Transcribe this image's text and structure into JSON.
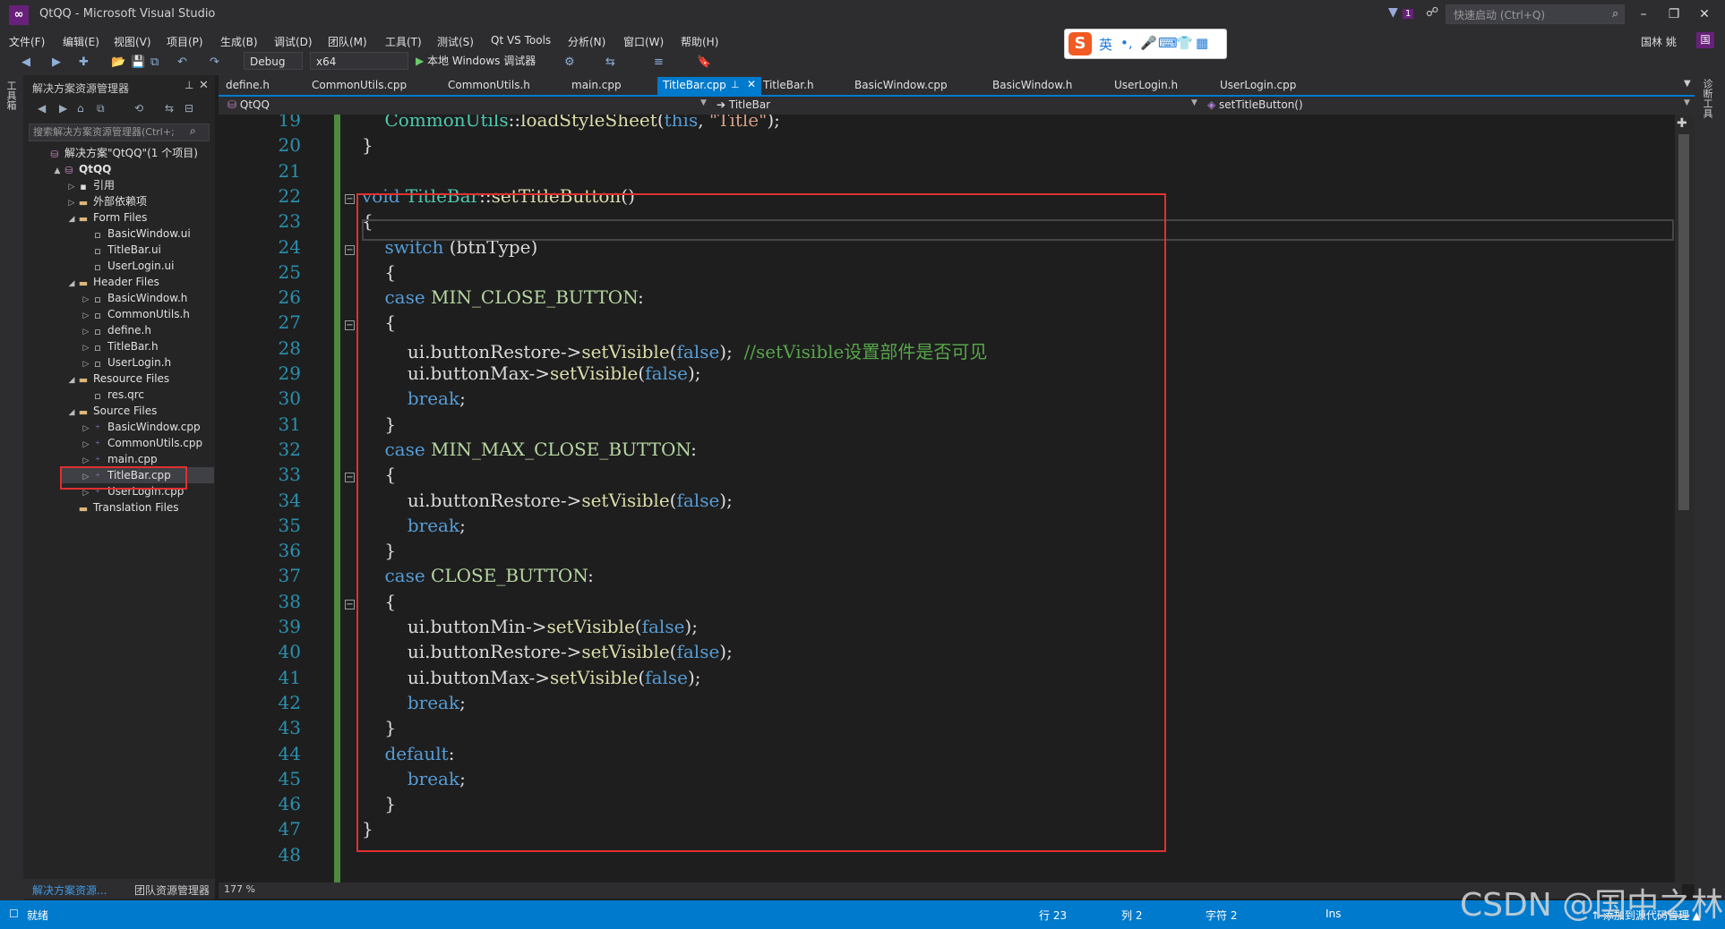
{
  "window": {
    "title": "QtQQ - Microsoft Visual Studio",
    "logo": "vs-logo",
    "quick_launch_placeholder": "快速启动 (Ctrl+Q)",
    "notification_count": "1",
    "user_name": "国林 姚",
    "user_initial": "国",
    "controls": [
      "minimize",
      "restore",
      "close"
    ]
  },
  "menu": [
    "文件(F)",
    "编辑(E)",
    "视图(V)",
    "项目(P)",
    "生成(B)",
    "调试(D)",
    "团队(M)",
    "工具(T)",
    "测试(S)",
    "Qt VS Tools",
    "分析(N)",
    "窗口(W)",
    "帮助(H)"
  ],
  "toolbar": {
    "config": "Debug",
    "platform": "x64",
    "run_label": "本地 Windows 调试器"
  },
  "ime": {
    "logo": "S",
    "items": [
      "英",
      "•,",
      "🎤",
      "⌨",
      "👕",
      "▦"
    ]
  },
  "left_strip": {
    "toolbox": "工具箱"
  },
  "right_strip": {
    "diagnostics": "诊断工具"
  },
  "solution_explorer": {
    "title": "解决方案资源管理器",
    "search_placeholder": "搜索解决方案资源管理器(Ctrl+;",
    "tree": [
      {
        "label": "解决方案\"QtQQ\"(1 个项目)",
        "indent": 0,
        "arrow": "",
        "icon": "solution-icon"
      },
      {
        "label": "QtQQ",
        "indent": 1,
        "arrow": "▲",
        "icon": "project-icon",
        "bold": true
      },
      {
        "label": "引用",
        "indent": 2,
        "arrow": "▷",
        "icon": "references-icon"
      },
      {
        "label": "外部依赖项",
        "indent": 2,
        "arrow": "▷",
        "icon": "folder-icon"
      },
      {
        "label": "Form Files",
        "indent": 2,
        "arrow": "◢",
        "icon": "folder-icon"
      },
      {
        "label": "BasicWindow.ui",
        "indent": 3,
        "arrow": "",
        "icon": "file-icon"
      },
      {
        "label": "TitleBar.ui",
        "indent": 3,
        "arrow": "",
        "icon": "file-icon"
      },
      {
        "label": "UserLogin.ui",
        "indent": 3,
        "arrow": "",
        "icon": "file-icon"
      },
      {
        "label": "Header Files",
        "indent": 2,
        "arrow": "◢",
        "icon": "folder-icon"
      },
      {
        "label": "BasicWindow.h",
        "indent": 3,
        "arrow": "▷",
        "icon": "header-icon"
      },
      {
        "label": "CommonUtils.h",
        "indent": 3,
        "arrow": "▷",
        "icon": "header-icon"
      },
      {
        "label": "define.h",
        "indent": 3,
        "arrow": "▷",
        "icon": "header-icon"
      },
      {
        "label": "TitleBar.h",
        "indent": 3,
        "arrow": "▷",
        "icon": "header-icon"
      },
      {
        "label": "UserLogin.h",
        "indent": 3,
        "arrow": "▷",
        "icon": "header-icon"
      },
      {
        "label": "Resource Files",
        "indent": 2,
        "arrow": "◢",
        "icon": "folder-icon"
      },
      {
        "label": "res.qrc",
        "indent": 3,
        "arrow": "",
        "icon": "file-icon"
      },
      {
        "label": "Source Files",
        "indent": 2,
        "arrow": "◢",
        "icon": "folder-icon"
      },
      {
        "label": "BasicWindow.cpp",
        "indent": 3,
        "arrow": "▷",
        "icon": "cpp-icon"
      },
      {
        "label": "CommonUtils.cpp",
        "indent": 3,
        "arrow": "▷",
        "icon": "cpp-icon"
      },
      {
        "label": "main.cpp",
        "indent": 3,
        "arrow": "▷",
        "icon": "cpp-icon"
      },
      {
        "label": "TitleBar.cpp",
        "indent": 3,
        "arrow": "▷",
        "icon": "cpp-icon",
        "selected": true
      },
      {
        "label": "UserLogin.cpp",
        "indent": 3,
        "arrow": "▷",
        "icon": "cpp-icon"
      },
      {
        "label": "Translation Files",
        "indent": 2,
        "arrow": "",
        "icon": "folder-icon"
      }
    ],
    "bottom_tabs": [
      "解决方案资源...",
      "团队资源管理器"
    ]
  },
  "tabs": [
    {
      "label": "define.h"
    },
    {
      "label": "CommonUtils.cpp"
    },
    {
      "label": "CommonUtils.h"
    },
    {
      "label": "main.cpp"
    },
    {
      "label": "TitleBar.cpp",
      "active": true
    },
    {
      "label": "TitleBar.h"
    },
    {
      "label": "BasicWindow.cpp"
    },
    {
      "label": "BasicWindow.h"
    },
    {
      "label": "UserLogin.h"
    },
    {
      "label": "UserLogin.cpp"
    }
  ],
  "navbar": {
    "project": "QtQQ",
    "scope": "TitleBar",
    "member": "setTitleButton()"
  },
  "editor": {
    "zoom": "177 %",
    "lines": [
      {
        "n": "19",
        "tokens": [
          [
            "    ",
            ""
          ],
          [
            "CommonUtils",
            "cls"
          ],
          [
            "::",
            ""
          ],
          [
            "loadStyleSheet",
            "fn"
          ],
          [
            "(",
            ""
          ],
          [
            "this",
            "kw"
          ],
          [
            ", ",
            ""
          ],
          [
            "\"Title\"",
            "str"
          ],
          [
            ");",
            ""
          ]
        ]
      },
      {
        "n": "20",
        "tokens": [
          [
            "}",
            ""
          ]
        ]
      },
      {
        "n": "21",
        "tokens": []
      },
      {
        "n": "22",
        "tokens": [
          [
            "void ",
            "kw"
          ],
          [
            "TitleBar",
            "cls"
          ],
          [
            "::",
            ""
          ],
          [
            "setTitleButton",
            "fn"
          ],
          [
            "()",
            ""
          ]
        ],
        "fold": true
      },
      {
        "n": "23",
        "tokens": [
          [
            "{",
            ""
          ]
        ]
      },
      {
        "n": "24",
        "tokens": [
          [
            "    ",
            ""
          ],
          [
            "switch",
            "kw"
          ],
          [
            " (",
            ""
          ],
          [
            "btnType",
            "var"
          ],
          [
            ")",
            ""
          ]
        ],
        "fold": true
      },
      {
        "n": "25",
        "tokens": [
          [
            "    {",
            ""
          ]
        ]
      },
      {
        "n": "26",
        "tokens": [
          [
            "    ",
            ""
          ],
          [
            "case",
            "kw"
          ],
          [
            " ",
            ""
          ],
          [
            "MIN_CLOSE_BUTTON",
            "cst"
          ],
          [
            ":",
            ""
          ]
        ]
      },
      {
        "n": "27",
        "tokens": [
          [
            "    {",
            ""
          ]
        ],
        "fold": true
      },
      {
        "n": "28",
        "tokens": [
          [
            "        ui",
            "var"
          ],
          [
            ".",
            ""
          ],
          [
            "buttonRestore",
            "var"
          ],
          [
            "->",
            ""
          ],
          [
            "setVisible",
            "fn"
          ],
          [
            "(",
            ""
          ],
          [
            "false",
            "kw"
          ],
          [
            ");  ",
            ""
          ],
          [
            "//setVisible设置部件是否可见",
            "cmt"
          ]
        ]
      },
      {
        "n": "29",
        "tokens": [
          [
            "        ui",
            "var"
          ],
          [
            ".",
            ""
          ],
          [
            "buttonMax",
            "var"
          ],
          [
            "->",
            ""
          ],
          [
            "setVisible",
            "fn"
          ],
          [
            "(",
            ""
          ],
          [
            "false",
            "kw"
          ],
          [
            ");",
            ""
          ]
        ]
      },
      {
        "n": "30",
        "tokens": [
          [
            "        ",
            ""
          ],
          [
            "break",
            "kw"
          ],
          [
            ";",
            ""
          ]
        ]
      },
      {
        "n": "31",
        "tokens": [
          [
            "    }",
            ""
          ]
        ]
      },
      {
        "n": "32",
        "tokens": [
          [
            "    ",
            ""
          ],
          [
            "case",
            "kw"
          ],
          [
            " ",
            ""
          ],
          [
            "MIN_MAX_CLOSE_BUTTON",
            "cst"
          ],
          [
            ":",
            ""
          ]
        ]
      },
      {
        "n": "33",
        "tokens": [
          [
            "    {",
            ""
          ]
        ],
        "fold": true
      },
      {
        "n": "34",
        "tokens": [
          [
            "        ui",
            "var"
          ],
          [
            ".",
            ""
          ],
          [
            "buttonRestore",
            "var"
          ],
          [
            "->",
            ""
          ],
          [
            "setVisible",
            "fn"
          ],
          [
            "(",
            ""
          ],
          [
            "false",
            "kw"
          ],
          [
            ");",
            ""
          ]
        ]
      },
      {
        "n": "35",
        "tokens": [
          [
            "        ",
            ""
          ],
          [
            "break",
            "kw"
          ],
          [
            ";",
            ""
          ]
        ]
      },
      {
        "n": "36",
        "tokens": [
          [
            "    }",
            ""
          ]
        ]
      },
      {
        "n": "37",
        "tokens": [
          [
            "    ",
            ""
          ],
          [
            "case",
            "kw"
          ],
          [
            " ",
            ""
          ],
          [
            "CLOSE_BUTTON",
            "cst"
          ],
          [
            ":",
            ""
          ]
        ]
      },
      {
        "n": "38",
        "tokens": [
          [
            "    {",
            ""
          ]
        ],
        "fold": true
      },
      {
        "n": "39",
        "tokens": [
          [
            "        ui",
            "var"
          ],
          [
            ".",
            ""
          ],
          [
            "buttonMin",
            "var"
          ],
          [
            "->",
            ""
          ],
          [
            "setVisible",
            "fn"
          ],
          [
            "(",
            ""
          ],
          [
            "false",
            "kw"
          ],
          [
            ");",
            ""
          ]
        ]
      },
      {
        "n": "40",
        "tokens": [
          [
            "        ui",
            "var"
          ],
          [
            ".",
            ""
          ],
          [
            "buttonRestore",
            "var"
          ],
          [
            "->",
            ""
          ],
          [
            "setVisible",
            "fn"
          ],
          [
            "(",
            ""
          ],
          [
            "false",
            "kw"
          ],
          [
            ");",
            ""
          ]
        ]
      },
      {
        "n": "41",
        "tokens": [
          [
            "        ui",
            "var"
          ],
          [
            ".",
            ""
          ],
          [
            "buttonMax",
            "var"
          ],
          [
            "->",
            ""
          ],
          [
            "setVisible",
            "fn"
          ],
          [
            "(",
            ""
          ],
          [
            "false",
            "kw"
          ],
          [
            ");",
            ""
          ]
        ]
      },
      {
        "n": "42",
        "tokens": [
          [
            "        ",
            ""
          ],
          [
            "break",
            "kw"
          ],
          [
            ";",
            ""
          ]
        ]
      },
      {
        "n": "43",
        "tokens": [
          [
            "    }",
            ""
          ]
        ]
      },
      {
        "n": "44",
        "tokens": [
          [
            "    ",
            ""
          ],
          [
            "default",
            "kw"
          ],
          [
            ":",
            ""
          ]
        ]
      },
      {
        "n": "45",
        "tokens": [
          [
            "        ",
            ""
          ],
          [
            "break",
            "kw"
          ],
          [
            ";",
            ""
          ]
        ]
      },
      {
        "n": "46",
        "tokens": [
          [
            "    }",
            ""
          ]
        ]
      },
      {
        "n": "47",
        "tokens": [
          [
            "}",
            ""
          ]
        ]
      },
      {
        "n": "48",
        "tokens": []
      }
    ]
  },
  "statusbar": {
    "ready": "就绪",
    "line": "行 23",
    "col": "列 2",
    "char": "字符 2",
    "mode": "Ins",
    "add_source": "↑ 添加到源代码管理 ▲"
  },
  "watermark": "CSDN @国中之林",
  "colors": {
    "accent": "#007acc",
    "highlight_box": "#e03030",
    "brand": "#68217a"
  }
}
